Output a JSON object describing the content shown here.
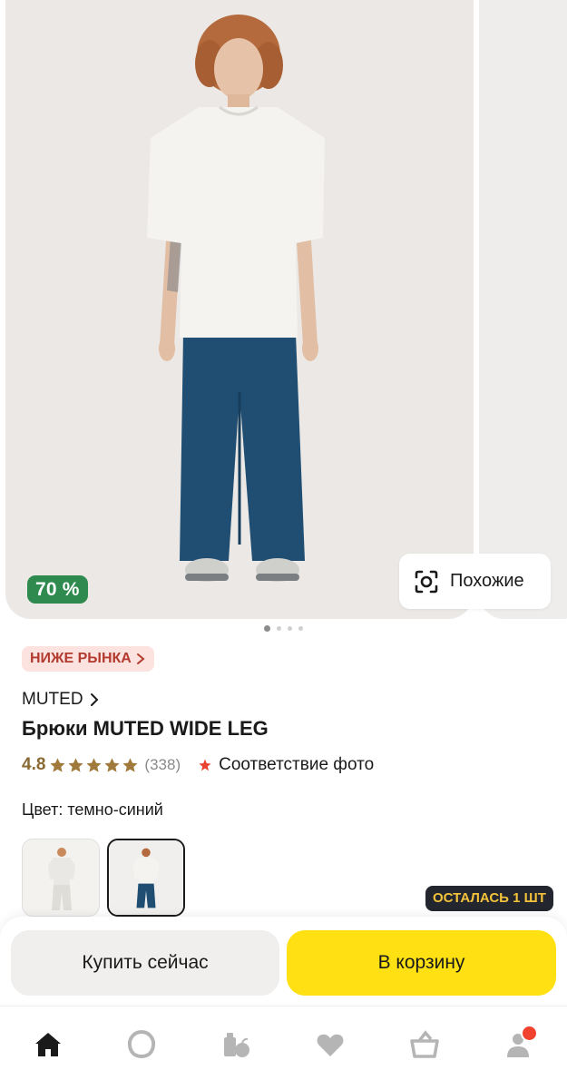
{
  "gallery": {
    "discount_badge": "70 %",
    "similar_button_label": "Похожие",
    "image_count": 4,
    "active_image": 1
  },
  "product": {
    "market_tag": "НИЖЕ РЫНКА",
    "brand": "MUTED",
    "title": "Брюки MUTED WIDE LEG",
    "rating": "4.8",
    "rating_stars": 5,
    "reviews_count": "(338)",
    "photo_match_label": "Соответствие фото",
    "color_label": "Цвет: темно-синий",
    "color_options": [
      {
        "name": "white-pants",
        "selected": false
      },
      {
        "name": "dark-blue-pants",
        "selected": true
      }
    ],
    "stock_tag": "ОСТАЛАСЬ 1 ШТ"
  },
  "actions": {
    "buy_now_label": "Купить сейчас",
    "add_to_cart_label": "В корзину"
  },
  "nav": {
    "items": [
      "home-icon",
      "alice-icon",
      "catalog-icon",
      "favorites-icon",
      "cart-icon",
      "profile-icon"
    ],
    "has_profile_notification": true
  },
  "colors": {
    "accent_yellow": "#ffe013",
    "discount_green": "#2f8a4f",
    "market_tag_bg": "#fde3df",
    "market_tag_text": "#b23a2e",
    "rating_gold": "#a07a3a",
    "stock_tag_bg": "#23262e",
    "stock_tag_text": "#f4c33b",
    "notification_red": "#f0422e"
  }
}
